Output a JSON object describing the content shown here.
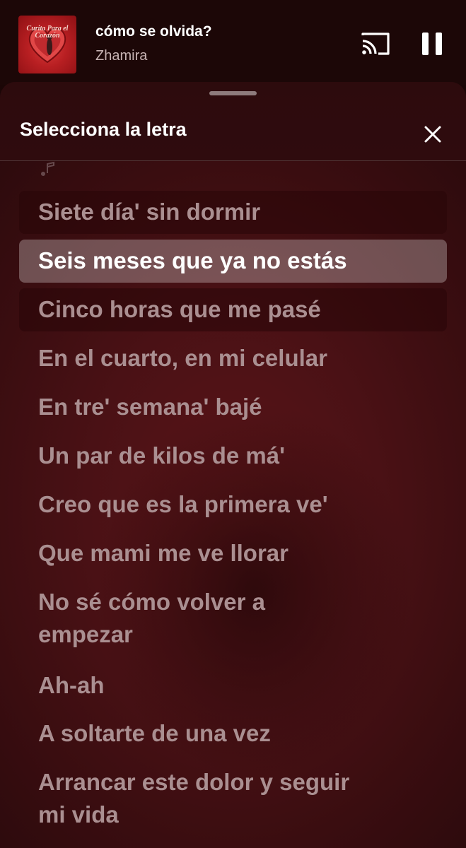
{
  "now_playing": {
    "title": "cómo se olvida?",
    "artist": "Zhamira",
    "cover_text": "Curita Para el Corazón",
    "icons": {
      "cast": "cast-icon",
      "pause": "pause-icon"
    }
  },
  "sheet": {
    "title": "Selecciona la letra",
    "close_icon": "close-icon"
  },
  "lyrics": [
    "Siete día' sin dormir",
    "Seis meses que ya no estás",
    "Cinco horas que me pasé",
    "En el cuarto, en mi celular",
    "En tre' semana' bajé",
    "Un par de kilos de má'",
    "Creo que es la primera ve'",
    "Que mami me ve llorar",
    "No sé cómo volver a empezar",
    "Ah-ah",
    "A soltarte de una vez",
    "Arrancar este dolor y seguir mi vida"
  ],
  "selected_index": 1,
  "colors": {
    "accent": "#5a1418",
    "selected_text": "#ffffff",
    "dim_text": "#aa8f91"
  }
}
